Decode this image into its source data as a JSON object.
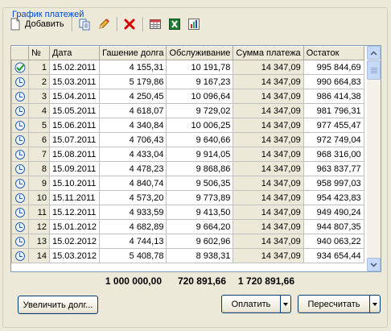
{
  "group_title": "График платежей",
  "toolbar": {
    "add_label": "Добавить",
    "icons": [
      "add-doc-icon",
      "copy-icon",
      "edit-pencil-icon",
      "delete-icon",
      "table-icon",
      "excel-icon",
      "chart-icon"
    ]
  },
  "grid": {
    "columns": [
      "№",
      "Дата",
      "Гашение долга",
      "Обслуживание",
      "Сумма платежа",
      "Остаток"
    ],
    "rows": [
      {
        "status": "paid",
        "n": "1",
        "date": "15.02.2011",
        "principal": "4 155,31",
        "service": "10 191,78",
        "payment": "14 347,09",
        "balance": "995 844,69"
      },
      {
        "status": "pending",
        "n": "2",
        "date": "15.03.2011",
        "principal": "5 179,86",
        "service": "9 167,23",
        "payment": "14 347,09",
        "balance": "990 664,83"
      },
      {
        "status": "pending",
        "n": "3",
        "date": "15.04.2011",
        "principal": "4 250,45",
        "service": "10 096,64",
        "payment": "14 347,09",
        "balance": "986 414,38"
      },
      {
        "status": "pending",
        "n": "4",
        "date": "15.05.2011",
        "principal": "4 618,07",
        "service": "9 729,02",
        "payment": "14 347,09",
        "balance": "981 796,31"
      },
      {
        "status": "pending",
        "n": "5",
        "date": "15.06.2011",
        "principal": "4 340,84",
        "service": "10 006,25",
        "payment": "14 347,09",
        "balance": "977 455,47"
      },
      {
        "status": "pending",
        "n": "6",
        "date": "15.07.2011",
        "principal": "4 706,43",
        "service": "9 640,66",
        "payment": "14 347,09",
        "balance": "972 749,04"
      },
      {
        "status": "pending",
        "n": "7",
        "date": "15.08.2011",
        "principal": "4 433,04",
        "service": "9 914,05",
        "payment": "14 347,09",
        "balance": "968 316,00"
      },
      {
        "status": "pending",
        "n": "8",
        "date": "15.09.2011",
        "principal": "4 478,23",
        "service": "9 868,86",
        "payment": "14 347,09",
        "balance": "963 837,77"
      },
      {
        "status": "pending",
        "n": "9",
        "date": "15.10.2011",
        "principal": "4 840,74",
        "service": "9 506,35",
        "payment": "14 347,09",
        "balance": "958 997,03"
      },
      {
        "status": "pending",
        "n": "10",
        "date": "15.11.2011",
        "principal": "4 573,20",
        "service": "9 773,89",
        "payment": "14 347,09",
        "balance": "954 423,83"
      },
      {
        "status": "pending",
        "n": "11",
        "date": "15.12.2011",
        "principal": "4 933,59",
        "service": "9 413,50",
        "payment": "14 347,09",
        "balance": "949 490,24"
      },
      {
        "status": "pending",
        "n": "12",
        "date": "15.01.2012",
        "principal": "4 682,89",
        "service": "9 664,20",
        "payment": "14 347,09",
        "balance": "944 807,35"
      },
      {
        "status": "pending",
        "n": "13",
        "date": "15.02.2012",
        "principal": "4 744,13",
        "service": "9 602,96",
        "payment": "14 347,09",
        "balance": "940 063,22"
      },
      {
        "status": "pending",
        "n": "14",
        "date": "15.03.2012",
        "principal": "5 408,78",
        "service": "8 938,31",
        "payment": "14 347,09",
        "balance": "934 654,44"
      }
    ]
  },
  "totals": {
    "principal": "1 000 000,00",
    "service": "720 891,66",
    "payment": "1 720 891,66"
  },
  "buttons": {
    "increase_debt": "Увеличить долг...",
    "pay": "Оплатить",
    "recalculate": "Пересчитать"
  }
}
